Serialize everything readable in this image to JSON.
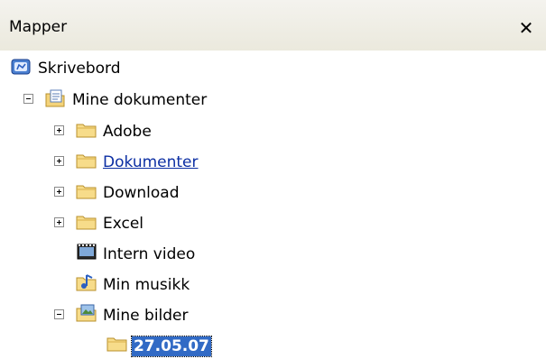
{
  "header": {
    "title": "Mapper",
    "close_label": "✕"
  },
  "tree": {
    "desktop": "Skrivebord",
    "my_documents": "Mine dokumenter",
    "adobe": "Adobe",
    "dokumenter": "Dokumenter",
    "download": "Download",
    "excel": "Excel",
    "intern_video": "Intern video",
    "min_musikk": "Min musikk",
    "mine_bilder": "Mine bilder",
    "selected_folder": "27.05.07"
  }
}
